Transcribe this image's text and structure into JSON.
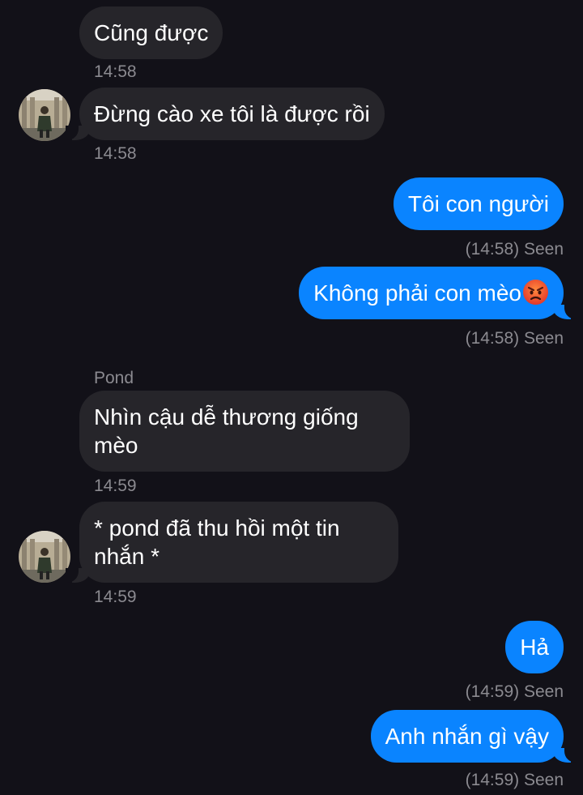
{
  "messages": [
    {
      "text": "Cũng được",
      "time": "14:58"
    },
    {
      "text": "Đừng cào xe tôi là được rồi",
      "time": "14:58"
    },
    {
      "text": "Tôi con người",
      "status": "(14:58) Seen"
    },
    {
      "text": "Không phải con mèo",
      "emoji": "angry-face-emoji",
      "status": "(14:58) Seen"
    },
    {
      "sender": "Pond",
      "text": "Nhìn cậu dễ thương giống mèo",
      "time": "14:59"
    },
    {
      "text": "* pond đã thu hồi một tin nhắn *",
      "time": "14:59"
    },
    {
      "text": "Hả",
      "status": "(14:59) Seen"
    },
    {
      "text": "Anh nhắn gì vậy",
      "status": "(14:59) Seen"
    }
  ],
  "colors": {
    "background": "#121118",
    "incoming_bubble": "#26252a",
    "outgoing_bubble": "#0a84ff",
    "meta_text": "#8b8a90"
  },
  "icons": {
    "avatar": "contact-avatar-photo",
    "emoji": "angry-face-emoji"
  }
}
